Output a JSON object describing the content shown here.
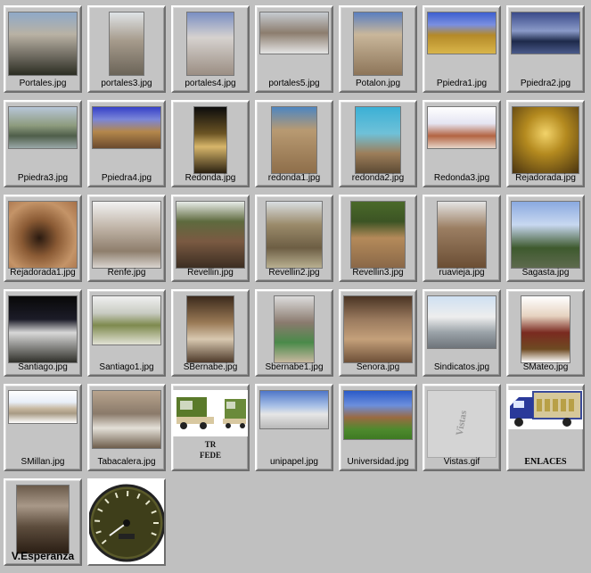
{
  "items": [
    {
      "label": "Portales.jpg",
      "icon": "street-photo-icon",
      "bg": "linear-gradient(180deg,#8fa9c8 0%,#b9b2a4 35%,#6e6a60 70%,#2b2d22 100%)",
      "w": 78,
      "h": 72,
      "row": 0,
      "col": 0
    },
    {
      "label": "portales3.jpg",
      "icon": "tower-photo-icon",
      "bg": "linear-gradient(180deg,#dfe3e6 0%,#a69b8c 45%,#6b6458 100%)",
      "w": 40,
      "h": 72,
      "row": 0,
      "col": 1
    },
    {
      "label": "portales4.jpg",
      "icon": "building-photo-icon",
      "bg": "linear-gradient(180deg,#7a8fc3 0%,#d6d2cf 40%,#9b8e83 100%)",
      "w": 54,
      "h": 72,
      "row": 0,
      "col": 2
    },
    {
      "label": "portales5.jpg",
      "icon": "street-photo-icon",
      "bg": "linear-gradient(180deg,#c6cbd1 0%,#8c7d6e 50%,#e4e4e4 100%)",
      "w": 78,
      "h": 48,
      "row": 0,
      "col": 3
    },
    {
      "label": "Potalon.jpg",
      "icon": "building-photo-icon",
      "bg": "linear-gradient(180deg,#5a7fc0 0%,#c9b79b 35%,#8d7559 100%)",
      "w": 56,
      "h": 72,
      "row": 0,
      "col": 4
    },
    {
      "label": "Ppiedra1.jpg",
      "icon": "bridge-photo-icon",
      "bg": "linear-gradient(180deg,#3d5fd0 0%,#7a8fe0 30%,#b48a28 55%,#d9b54a 100%)",
      "w": 78,
      "h": 48,
      "row": 0,
      "col": 5
    },
    {
      "label": "Ppiedra2.jpg",
      "icon": "bridge-photo-icon",
      "bg": "linear-gradient(180deg,#3a4a8a 0%,#8a9ac8 45%,#1e2a4a 70%,#4a5a8a 100%)",
      "w": 78,
      "h": 48,
      "row": 0,
      "col": 6
    },
    {
      "label": "Ppiedra3.jpg",
      "icon": "bridge-photo-icon",
      "bg": "linear-gradient(180deg,#b7c6d8 0%,#8d9b7e 45%,#4f5e4a 70%,#9aa8a8 100%)",
      "w": 78,
      "h": 48,
      "row": 1,
      "col": 0
    },
    {
      "label": "Ppiedra4.jpg",
      "icon": "bridge-photo-icon",
      "bg": "linear-gradient(180deg,#3540c8 0%,#7a86d8 30%,#b4874b 60%,#6b4a2e 100%)",
      "w": 78,
      "h": 48,
      "row": 1,
      "col": 1
    },
    {
      "label": "Redonda.jpg",
      "icon": "church-night-photo-icon",
      "bg": "linear-gradient(180deg,#0c0c0c 0%,#6b5424 40%,#d7b66a 60%,#2a2010 100%)",
      "w": 38,
      "h": 76,
      "row": 1,
      "col": 2
    },
    {
      "label": "redonda1.jpg",
      "icon": "church-photo-icon",
      "bg": "linear-gradient(180deg,#4e86c0 0%,#b89a72 35%,#8e6e4a 100%)",
      "w": 52,
      "h": 76,
      "row": 1,
      "col": 3
    },
    {
      "label": "redonda2.jpg",
      "icon": "church-photo-icon",
      "bg": "linear-gradient(180deg,#3bb0d6 0%,#6fc1d8 40%,#9d7e5a 70%,#5c4a34 100%)",
      "w": 52,
      "h": 76,
      "row": 1,
      "col": 4
    },
    {
      "label": "Redonda3.jpg",
      "icon": "church-photo-icon",
      "bg": "linear-gradient(180deg,#ffffff 0%,#e5e5f2 40%,#b36442 70%,#e7d5c8 100%)",
      "w": 78,
      "h": 48,
      "row": 1,
      "col": 5
    },
    {
      "label": "Rejadorada.jpg",
      "icon": "cellar-photo-icon",
      "bg": "radial-gradient(circle at 50% 40%,#f2d36a 0%,#b48a1f 40%,#4a3410 100%)",
      "w": 76,
      "h": 76,
      "row": 1,
      "col": 6
    },
    {
      "label": "Rejadorada1.jpg",
      "icon": "tunnel-photo-icon",
      "bg": "radial-gradient(circle at 45% 55%,#2a1a10 0%,#8a5a34 35%,#c49468 70%,#a67048 100%)",
      "w": 78,
      "h": 76,
      "row": 2,
      "col": 0
    },
    {
      "label": "Renfe.jpg",
      "icon": "station-photo-icon",
      "bg": "linear-gradient(180deg,#f2f2f2 0%,#bfb3a6 40%,#8e7e6c 75%,#d9d4cf 100%)",
      "w": 78,
      "h": 76,
      "row": 2,
      "col": 1
    },
    {
      "label": "Revellin.jpg",
      "icon": "wall-photo-icon",
      "bg": "linear-gradient(180deg,#e8ece8 0%,#5e6a3e 30%,#7a5a42 60%,#3c2e22 100%)",
      "w": 78,
      "h": 76,
      "row": 2,
      "col": 2
    },
    {
      "label": "Revellin2.jpg",
      "icon": "gate-photo-icon",
      "bg": "linear-gradient(180deg,#d9dee2 0%,#9a8a6a 35%,#6d5e44 70%,#b9b091 100%)",
      "w": 64,
      "h": 76,
      "row": 2,
      "col": 3
    },
    {
      "label": "Revellin3.jpg",
      "icon": "wall-photo-icon",
      "bg": "linear-gradient(180deg,#4a6a2a 0%,#3c5424 30%,#b48a5a 55%,#8a6848 100%)",
      "w": 62,
      "h": 76,
      "row": 2,
      "col": 4
    },
    {
      "label": "ruavieja.jpg",
      "icon": "street-photo-icon",
      "bg": "linear-gradient(180deg,#e4e4e4 0%,#9b7e62 40%,#6b4e34 100%)",
      "w": 56,
      "h": 76,
      "row": 2,
      "col": 5
    },
    {
      "label": "Sagasta.jpg",
      "icon": "statue-photo-icon",
      "bg": "linear-gradient(180deg,#8aa9e0 0%,#c8d8f0 35%,#3e5a2e 70%,#5e6a4e 100%)",
      "w": 78,
      "h": 76,
      "row": 2,
      "col": 6
    },
    {
      "label": "Santiago.jpg",
      "icon": "church-night-photo-icon",
      "bg": "linear-gradient(180deg,#080808 0%,#1c1c28 35%,#d8d8d8 55%,#30302a 100%)",
      "w": 78,
      "h": 76,
      "row": 3,
      "col": 0
    },
    {
      "label": "Santiago1.jpg",
      "icon": "sculpture-photo-icon",
      "bg": "linear-gradient(180deg,#f0f0f0 0%,#c8cbc2 35%,#7e8a4e 60%,#e2e2d6 100%)",
      "w": 78,
      "h": 56,
      "row": 3,
      "col": 1
    },
    {
      "label": "SBernabe.jpg",
      "icon": "altar-photo-icon",
      "bg": "linear-gradient(180deg,#3c2a1c 0%,#9a7a56 40%,#d8c8b0 65%,#4e3a2a 100%)",
      "w": 54,
      "h": 76,
      "row": 3,
      "col": 2
    },
    {
      "label": "Sbernabe1.jpg",
      "icon": "procession-photo-icon",
      "bg": "linear-gradient(180deg,#dcdcdc 0%,#8a7a6e 40%,#4a8a4a 70%,#c8b8a0 100%)",
      "w": 46,
      "h": 76,
      "row": 3,
      "col": 3
    },
    {
      "label": "Senora.jpg",
      "icon": "fountain-photo-icon",
      "bg": "linear-gradient(180deg,#4a3424 0%,#9a7a5e 35%,#c4a07a 65%,#6e5038 100%)",
      "w": 78,
      "h": 76,
      "row": 3,
      "col": 4
    },
    {
      "label": "Sindicatos.jpg",
      "icon": "building-photo-icon",
      "bg": "linear-gradient(180deg,#cfe0f2 0%,#eeeeee 40%,#9aa2a8 70%,#6e747a 100%)",
      "w": 78,
      "h": 60,
      "row": 3,
      "col": 5
    },
    {
      "label": "SMateo.jpg",
      "icon": "festival-photo-icon",
      "bg": "linear-gradient(180deg,#ffffff 0%,#e6d2c0 30%,#7a2a20 55%,#6e4a22 80%,#ffffff 100%)",
      "w": 56,
      "h": 76,
      "row": 3,
      "col": 6
    },
    {
      "label": "SMillan.jpg",
      "icon": "building-photo-icon",
      "bg": "linear-gradient(180deg,#ffffff 0%,#e8eef8 35%,#c7b8a0 55%,#a89a84 70%,#ffffff 100%)",
      "w": 78,
      "h": 38,
      "row": 4,
      "col": 0
    },
    {
      "label": "Tabacalera.jpg",
      "icon": "sculpture-photo-icon",
      "bg": "linear-gradient(180deg,#b8a48e 0%,#8a7a6a 40%,#e4e0d8 65%,#6e5e4c 100%)",
      "w": 78,
      "h": 66,
      "row": 4,
      "col": 1
    },
    {
      "label": "",
      "icon": "truck-photo-icon",
      "bg": "#ffffff",
      "w": 84,
      "h": 52,
      "row": 4,
      "col": 2,
      "inner": "TR\nFEDE"
    },
    {
      "label": "unipapel.jpg",
      "icon": "factory-photo-icon",
      "bg": "linear-gradient(180deg,#4e76c8 0%,#a8c0e6 40%,#e6e6e6 62%,#b9b9b9 100%)",
      "w": 78,
      "h": 44,
      "row": 4,
      "col": 3
    },
    {
      "label": "Universidad.jpg",
      "icon": "campus-photo-icon",
      "bg": "linear-gradient(180deg,#2a5ac8 0%,#6c8fdc 30%,#9a6a42 55%,#4e8a2e 80%,#3e7a22 100%)",
      "w": 78,
      "h": 56,
      "row": 4,
      "col": 4
    },
    {
      "label": "Vistas.gif",
      "icon": "vistas-image-icon",
      "bg": "#d4d4d4",
      "w": 78,
      "h": 76,
      "row": 4,
      "col": 5,
      "inner": "Vistas"
    },
    {
      "label": "ENLACES",
      "icon": "delivery-truck-icon",
      "bg": "#ffffff",
      "w": 84,
      "h": 44,
      "row": 4,
      "col": 6,
      "labelStyle": "bold"
    },
    {
      "label": "V.Esperanza",
      "icon": "virgin-altar-photo-icon",
      "bg": "linear-gradient(180deg,#6a5a4a 0%,#a89888 30%,#5e4e3e 60%,#2a1e14 100%)",
      "w": 60,
      "h": 78,
      "row": 5,
      "col": 0,
      "labelStyle": "big"
    },
    {
      "label": "",
      "icon": "speedometer-icon",
      "bg": "#ffffff",
      "w": 86,
      "h": 96,
      "row": 5,
      "col": 1
    }
  ]
}
